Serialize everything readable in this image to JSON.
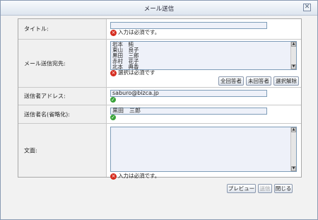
{
  "dialog": {
    "title": "メール送信",
    "close_glyph": "✕"
  },
  "fields": {
    "title": {
      "label": "タイトル:",
      "value": "",
      "error": "入力は必須です。"
    },
    "recipients": {
      "label": "メール送信宛先:",
      "items": [
        "岩本　純",
        "東山　良子",
        "黒田　三郎",
        "赤村　花子",
        "北本　典香"
      ],
      "error": "選択は必須です",
      "buttons": {
        "select_all": "全回答者",
        "unanswered": "未回答者",
        "clear": "選択解除"
      }
    },
    "sender_address": {
      "label": "送信者アドレス:",
      "value": "saburo@bizca.jp"
    },
    "sender_name": {
      "label": "送信者名(省略化):",
      "value": "黒田　三郎"
    },
    "body": {
      "label": "文面:",
      "value": "",
      "error": "入力は必須です。"
    }
  },
  "footer": {
    "preview": "プレビュー",
    "send": "送信",
    "close": "閉じる"
  },
  "icons": {
    "error": "error-icon",
    "ok": "check-icon",
    "scroll_up": "▲",
    "scroll_down": "▼"
  }
}
